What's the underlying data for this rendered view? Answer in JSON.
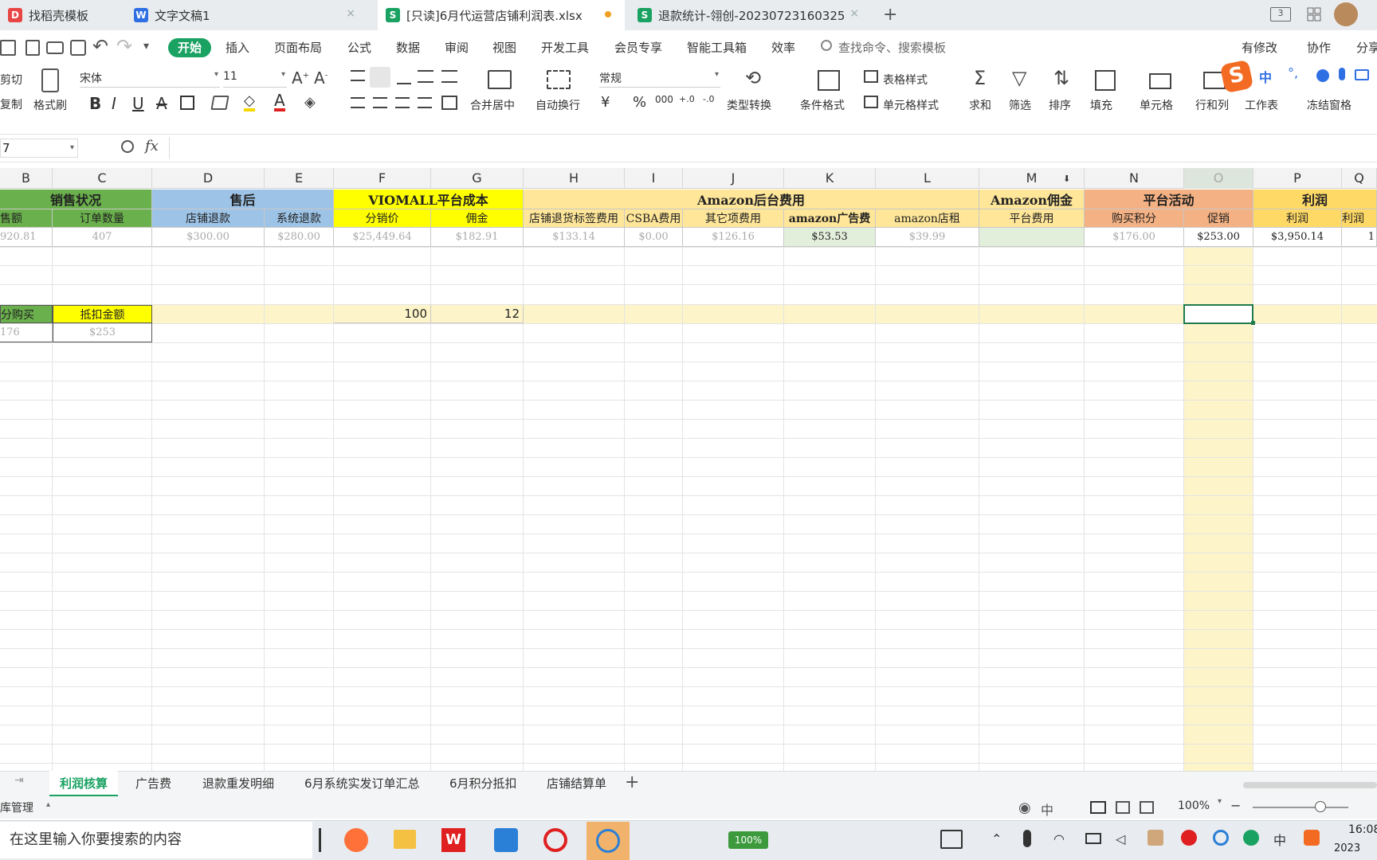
{
  "tabs": [
    {
      "label": "找稻壳模板",
      "icon": "docer-icon",
      "color": "#e84545"
    },
    {
      "label": "文字文稿1",
      "icon": "wps-writer-icon",
      "color": "#2f6fe4"
    },
    {
      "label": "[只读]6月代运营店铺利润表.xlsx",
      "icon": "wps-sheet-icon",
      "color": "#1aa262"
    },
    {
      "label": "退款统计-翎创-20230723160325",
      "icon": "wps-sheet-icon",
      "color": "#1aa262"
    }
  ],
  "menu": {
    "items": [
      "开始",
      "插入",
      "页面布局",
      "公式",
      "数据",
      "审阅",
      "视图",
      "开发工具",
      "会员专享",
      "智能工具箱",
      "效率"
    ],
    "search_placeholder": "查找命令、搜索模板",
    "has_changes": "有修改",
    "collaborate": "协作",
    "share": "分享"
  },
  "ribbon": {
    "cut": "剪切",
    "copy": "复制",
    "format_painter": "格式刷",
    "font_name": "宋体",
    "font_size": "11",
    "merge_center": "合并居中",
    "wrap_text": "自动换行",
    "number_format": "常规",
    "type_convert": "类型转换",
    "conditional_format": "条件格式",
    "table_style": "表格样式",
    "cell_style": "单元格样式",
    "sum": "求和",
    "filter": "筛选",
    "sort": "排序",
    "fill": "填充",
    "cell": "单元格",
    "row_col": "行和列",
    "worksheet": "工作表",
    "freeze": "冻结窗格",
    "ime_label": "中"
  },
  "formula_bar": {
    "cell_ref": "7",
    "fx": "fx",
    "value": ""
  },
  "columns": [
    "B",
    "C",
    "D",
    "E",
    "F",
    "G",
    "H",
    "I",
    "J",
    "K",
    "L",
    "M",
    "N",
    "O",
    "P",
    "Q"
  ],
  "sheet": {
    "group_headers": [
      "销售状况",
      "售后",
      "VIOMALL平台成本",
      "Amazon后台费用",
      "Amazon佣金",
      "平台活动",
      "利润"
    ],
    "sub_headers": [
      "售额",
      "订单数量",
      "店铺退款",
      "系统退款",
      "分销价",
      "佣金",
      "店铺退货标签费用",
      "CSBA费用",
      "其它项费用",
      "amazon广告费",
      "amazon店租",
      "平台费用",
      "购买积分",
      "促销",
      "利润",
      "利润"
    ],
    "data_row": [
      "920.81",
      "407",
      "$300.00",
      "$280.00",
      "$25,449.64",
      "$182.91",
      "$133.14",
      "$0.00",
      "$126.16",
      "$53.53",
      "$39.99",
      "",
      "$176.00",
      "$253.00",
      "$3,950.14",
      "1"
    ],
    "row_a_labels": [
      "分购买",
      "抵扣金额"
    ],
    "row_a_values": [
      "100",
      "12"
    ],
    "row_b_values": [
      "176",
      "$253"
    ]
  },
  "sheet_tabs": [
    "利润核算",
    "广告费",
    "退款重发明细",
    "6月系统实发订单汇总",
    "6月积分抵扣",
    "店铺结算单"
  ],
  "status": {
    "left": "库管理",
    "zoom": "100%"
  },
  "taskbar": {
    "search_placeholder": "在这里输入你要搜索的内容",
    "battery": "100%",
    "time": "16:08",
    "date": "2023"
  },
  "colors": {
    "green_header": "#6ab04c",
    "blue_header": "#9dc3e6",
    "yellow_header": "#ffff00",
    "amazon_header": "#ffe699",
    "orange_header": "#f4b183",
    "light_yellow_row": "#ffffcc",
    "accent_green": "#1aa262"
  }
}
